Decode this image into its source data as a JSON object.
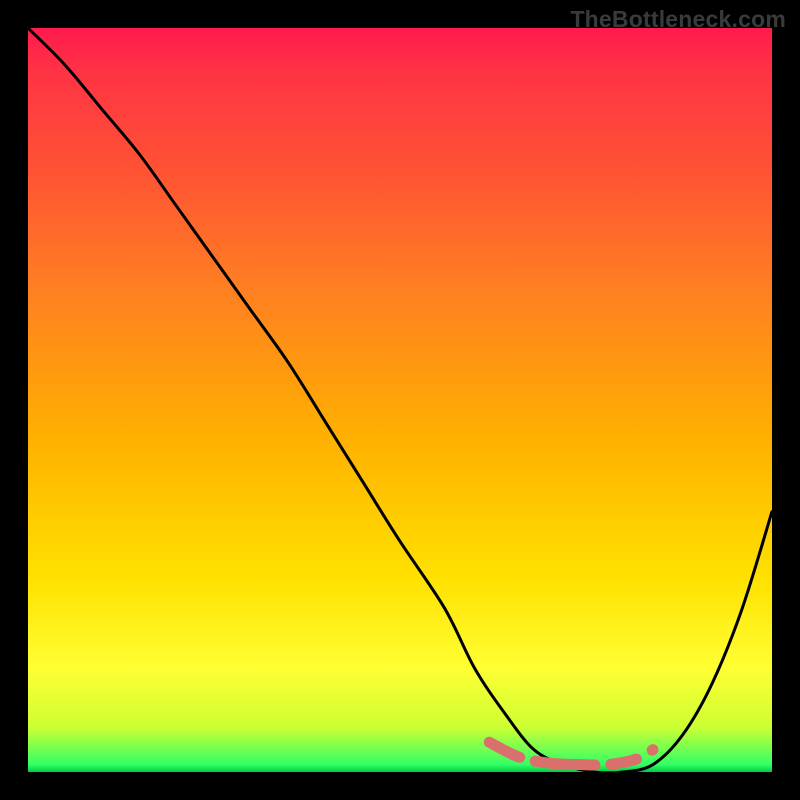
{
  "watermark": "TheBottleneck.com",
  "chart_data": {
    "type": "line",
    "title": "",
    "xlabel": "",
    "ylabel": "",
    "xlim": [
      0,
      100
    ],
    "ylim": [
      0,
      100
    ],
    "grid": false,
    "legend": false,
    "background_gradient": [
      "#ff1a4d",
      "#ff7f22",
      "#ffe100",
      "#ffff33",
      "#00cc44"
    ],
    "series": [
      {
        "name": "bottleneck-curve",
        "color": "#000000",
        "x": [
          0,
          5,
          10,
          15,
          20,
          25,
          30,
          35,
          40,
          45,
          50,
          56,
          60,
          64,
          68,
          72,
          76,
          80,
          84,
          88,
          92,
          96,
          100
        ],
        "values": [
          100,
          95,
          89,
          83,
          76,
          69,
          62,
          55,
          47,
          39,
          31,
          22,
          14,
          8,
          3,
          1,
          0,
          0,
          1,
          5,
          12,
          22,
          35
        ]
      },
      {
        "name": "recommended-range-marker",
        "color": "#d9706b",
        "style": "dashed",
        "x": [
          62,
          66,
          70,
          74,
          78,
          82,
          84
        ],
        "values": [
          4,
          2,
          1.2,
          1,
          1,
          1.8,
          3
        ]
      }
    ],
    "annotations": []
  }
}
